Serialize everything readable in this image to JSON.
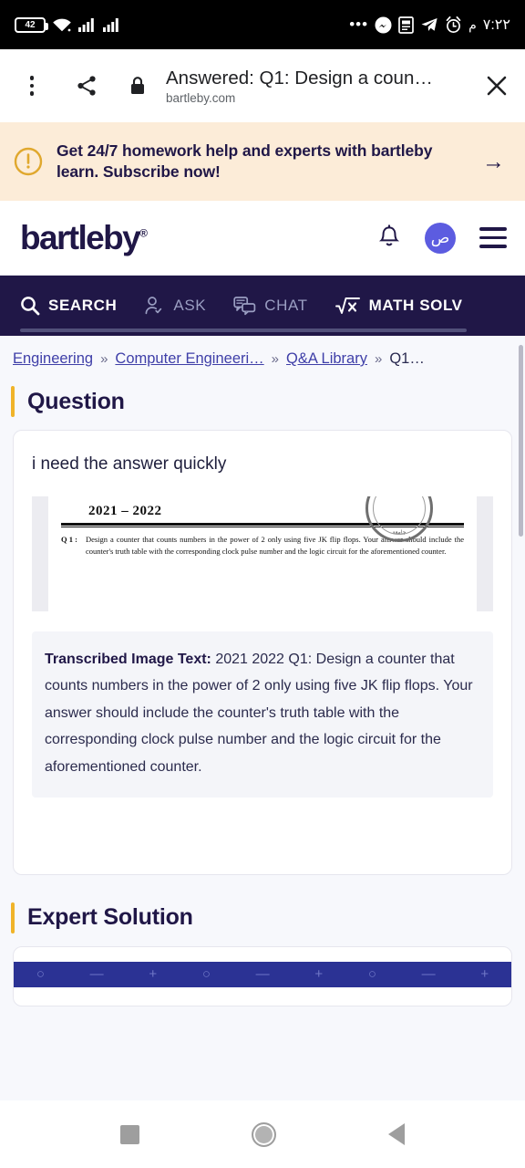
{
  "status_bar": {
    "battery_level": "42",
    "time": "٧:٢٢",
    "meridiem": "م",
    "icons": [
      "battery-icon",
      "wifi-icon",
      "signal-icon-sim1",
      "signal-icon-sim2",
      "overflow-dots-icon",
      "messenger-icon",
      "news-icon",
      "telegram-icon",
      "alarm-icon"
    ]
  },
  "browser_bar": {
    "page_title": "Answered: Q1: Design a coun…",
    "url": "bartleby.com",
    "menu_icon": "kebab-menu-icon",
    "share_icon": "share-icon",
    "lock_icon": "lock-icon",
    "close_icon": "close-icon"
  },
  "promo": {
    "icon": "alert-circle-icon",
    "message": "Get 24/7 homework help and experts with bartleby learn. Subscribe now!",
    "arrow": "→",
    "bg_color": "#fcecd8",
    "text_color": "#201747"
  },
  "site_header": {
    "logo_text": "bartleby",
    "logo_mark": "®",
    "bell_icon": "notification-bell-icon",
    "avatar_initial": "ص",
    "avatar_color": "#5c5ce0",
    "menu_icon": "hamburger-menu-icon"
  },
  "nav": {
    "bg_color": "#201747",
    "items": [
      {
        "label": "SEARCH",
        "icon": "search-icon",
        "active": true
      },
      {
        "label": "ASK",
        "icon": "ask-person-icon",
        "active": false
      },
      {
        "label": "CHAT",
        "icon": "chat-bubbles-icon",
        "active": false
      },
      {
        "label": "MATH SOLV",
        "icon": "math-radical-icon",
        "active": true
      }
    ]
  },
  "breadcrumb": {
    "items": [
      "Engineering",
      "Computer Engineeri…",
      "Q&A Library",
      "Q1…"
    ],
    "separator": "»"
  },
  "question_section": {
    "heading": "Question",
    "accent_color": "#f0b429",
    "user_text": "i need the answer quickly",
    "scan_image": {
      "year": "2021 – 2022",
      "seal_text": "جامعة",
      "q_label": "Q 1 :",
      "q_body": "Design a counter that counts numbers in the power of 2 only using five JK flip flops. Your answer should include the counter's truth table with the corresponding clock pulse number and the logic circuit for the aforementioned counter."
    },
    "transcription": {
      "label": "Transcribed Image Text:",
      "text": " 2021 2022 Q1: Design a counter that counts numbers in the power of 2 only using five JK flip flops. Your answer should include the counter's truth table with the corresponding clock pulse number and the logic circuit for the aforementioned counter."
    }
  },
  "expert_section": {
    "heading": "Expert Solution",
    "accent_color": "#f0b429",
    "banner_symbols": [
      "○",
      "—",
      "+",
      "○",
      "—",
      "+",
      "○",
      "—",
      "+"
    ],
    "banner_color": "#2b3294"
  },
  "android_nav": {
    "recents": "recents-square-button",
    "home": "home-circle-button",
    "back": "back-triangle-button"
  }
}
